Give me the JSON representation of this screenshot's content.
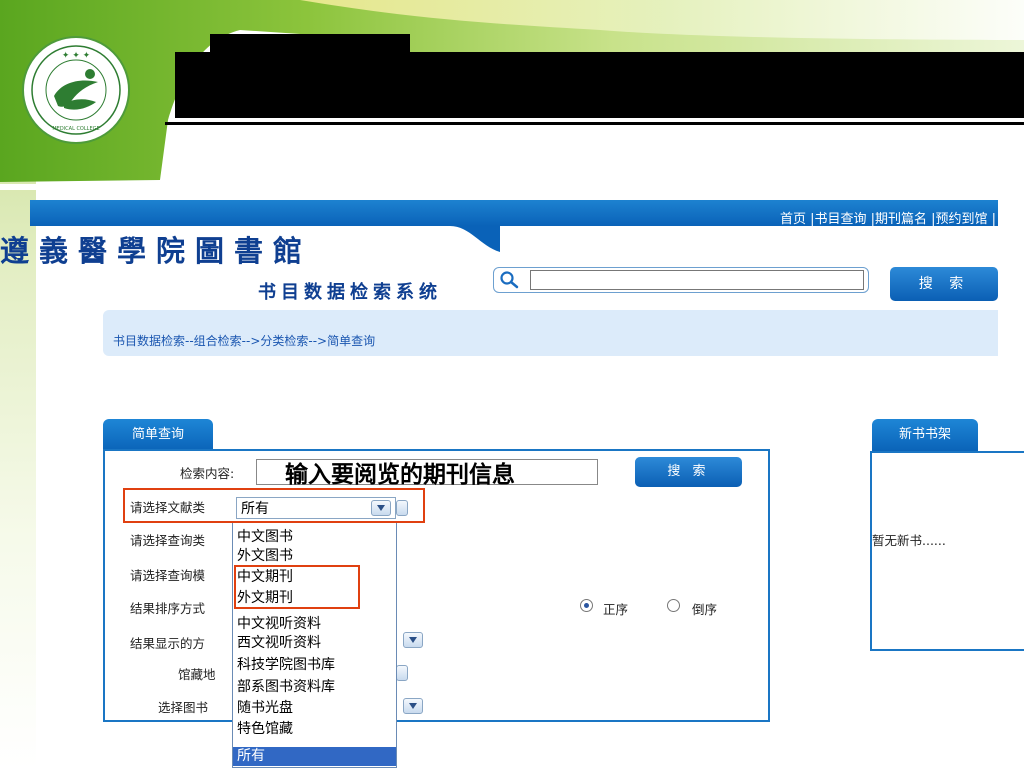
{
  "header": {
    "nav_links": "首页 |书目查询 |期刊篇名 |预约到馆 |",
    "library_name": "遵義醫學院圖書館",
    "system_name": "书目数据检索系统",
    "search_placeholder": "",
    "search_button": "搜 索"
  },
  "breadcrumb": "书目数据检索--组合检索-->分类检索-->简单查询",
  "simple_query": {
    "tab": "简单查询",
    "search_label": "检索内容:",
    "search_value": "输入要阅览的期刊信息",
    "search_button": "搜 索",
    "fields": {
      "doc_type": "请选择文献类",
      "query_type": "请选择查询类",
      "query_mode": "请选择查询模",
      "sort_order": "结果排序方式",
      "display_mode": "结果显示的方",
      "location": "馆藏地",
      "book_select": "选择图书"
    },
    "doc_type_selected": "所有",
    "doc_type_options": [
      "中文图书",
      "外文图书",
      "中文期刊",
      "外文期刊",
      "中文视听资料",
      "西文视听资料",
      "科技学院图书库",
      "部系图书资料库",
      "随书光盘",
      "特色馆藏",
      "所有"
    ],
    "sort": {
      "asc": "正序",
      "desc": "倒序",
      "selected": "正序"
    }
  },
  "new_books": {
    "tab": "新书书架",
    "empty_text": "暂无新书......"
  },
  "colors": {
    "brand_blue": "#0a62b8",
    "highlight_red": "#e04010",
    "accent_green": "#7ab828"
  }
}
